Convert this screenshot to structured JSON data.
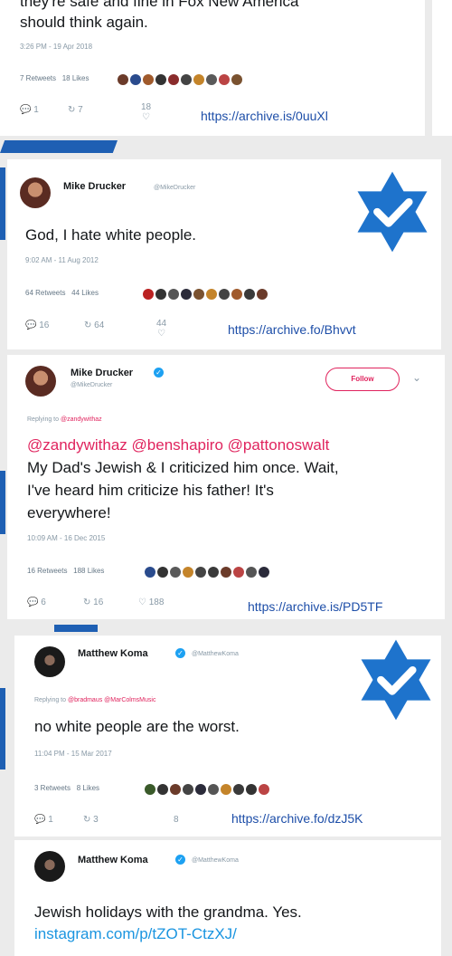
{
  "tweet0": {
    "text_line1": "they're safe and fine in Fox New America",
    "text_line2": "should think again.",
    "timestamp": "3:26 PM - 19 Apr 2018",
    "retweets": "7 Retweets",
    "likes": "18 Likes",
    "reply_count": "1",
    "retweet_count": "7",
    "like_count": "18",
    "archive_link": "https://archive.is/0uuXl"
  },
  "tweet1": {
    "name": "Mike Drucker",
    "handle": "@MikeDrucker",
    "text": "God, I hate white people.",
    "timestamp": "9:02 AM - 11 Aug 2012",
    "retweets": "64 Retweets",
    "likes": "44 Likes",
    "reply_count": "16",
    "retweet_count": "64",
    "like_count": "44",
    "archive_link": "https://archive.fo/Bhvvt"
  },
  "tweet2": {
    "name": "Mike Drucker",
    "handle": "@MikeDrucker",
    "follow_label": "Follow",
    "replying_to_prefix": "Replying to",
    "replying_to_handle": "@zandywithaz",
    "mentions": "@zandywithaz @benshapiro @pattonoswalt",
    "text_line1": "My Dad's Jewish & I criticized him once. Wait,",
    "text_line2": "I've heard him criticize his father! It's",
    "text_line3": "everywhere!",
    "timestamp": "10:09 AM - 16 Dec 2015",
    "retweets": "16 Retweets",
    "likes": "188 Likes",
    "reply_count": "6",
    "retweet_count": "16",
    "like_count": "188",
    "archive_link": "https://archive.is/PD5TF"
  },
  "tweet3": {
    "name": "Matthew Koma",
    "handle": "@MatthewKoma",
    "replying_to_prefix": "Replying to",
    "replying_to_handle": "@bradmaus @MarColmsMusic",
    "text": "no white people are the worst.",
    "timestamp": "11:04 PM - 15 Mar 2017",
    "retweets": "3 Retweets",
    "likes": "8 Likes",
    "reply_count": "1",
    "retweet_count": "3",
    "like_count": "8",
    "archive_link": "https://archive.fo/dzJ5K"
  },
  "tweet4": {
    "name": "Matthew Koma",
    "handle": "@MatthewKoma",
    "text": "Jewish holidays with the grandma. Yes.",
    "link": "instagram.com/p/tZOT-CtzXJ/"
  },
  "colors": {
    "star_blue": "#1e73cc",
    "link_blue": "#1d4ea8",
    "mention_pink": "#e0245e",
    "verified_blue": "#1da1f2"
  }
}
